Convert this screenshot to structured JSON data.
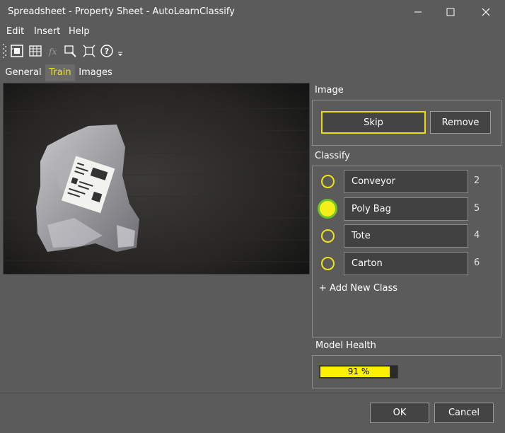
{
  "window": {
    "title": "Spreadsheet - Property Sheet - AutoLearnClassify"
  },
  "menu": {
    "items": [
      "Edit",
      "Insert",
      "Help"
    ]
  },
  "toolbar": {
    "icons": [
      "spreadsheet-view-icon",
      "table-grid-icon",
      "function-icon",
      "zoom-region-icon",
      "fit-icon",
      "help-icon",
      "overflow-icon"
    ]
  },
  "tabs": [
    {
      "label": "General",
      "active": false
    },
    {
      "label": "Train",
      "active": true
    },
    {
      "label": "Images",
      "active": false
    }
  ],
  "image_section": {
    "label": "Image",
    "skip_label": "Skip",
    "remove_label": "Remove"
  },
  "classify_section": {
    "label": "Classify",
    "classes": [
      {
        "name": "Conveyor",
        "count": "2",
        "selected": false
      },
      {
        "name": "Poly Bag",
        "count": "5",
        "selected": true
      },
      {
        "name": "Tote",
        "count": "4",
        "selected": false
      },
      {
        "name": "Carton",
        "count": "6",
        "selected": false
      }
    ],
    "add_label": "+ Add New Class"
  },
  "model_health": {
    "label": "Model Health",
    "value_text": "91 %",
    "value": 0.91
  },
  "footer": {
    "ok_label": "OK",
    "cancel_label": "Cancel"
  },
  "colors": {
    "accent": "#f4e41a",
    "selected_ring": "#6cc32a",
    "background": "#5b5b5b",
    "health_fill": "#fff200"
  }
}
